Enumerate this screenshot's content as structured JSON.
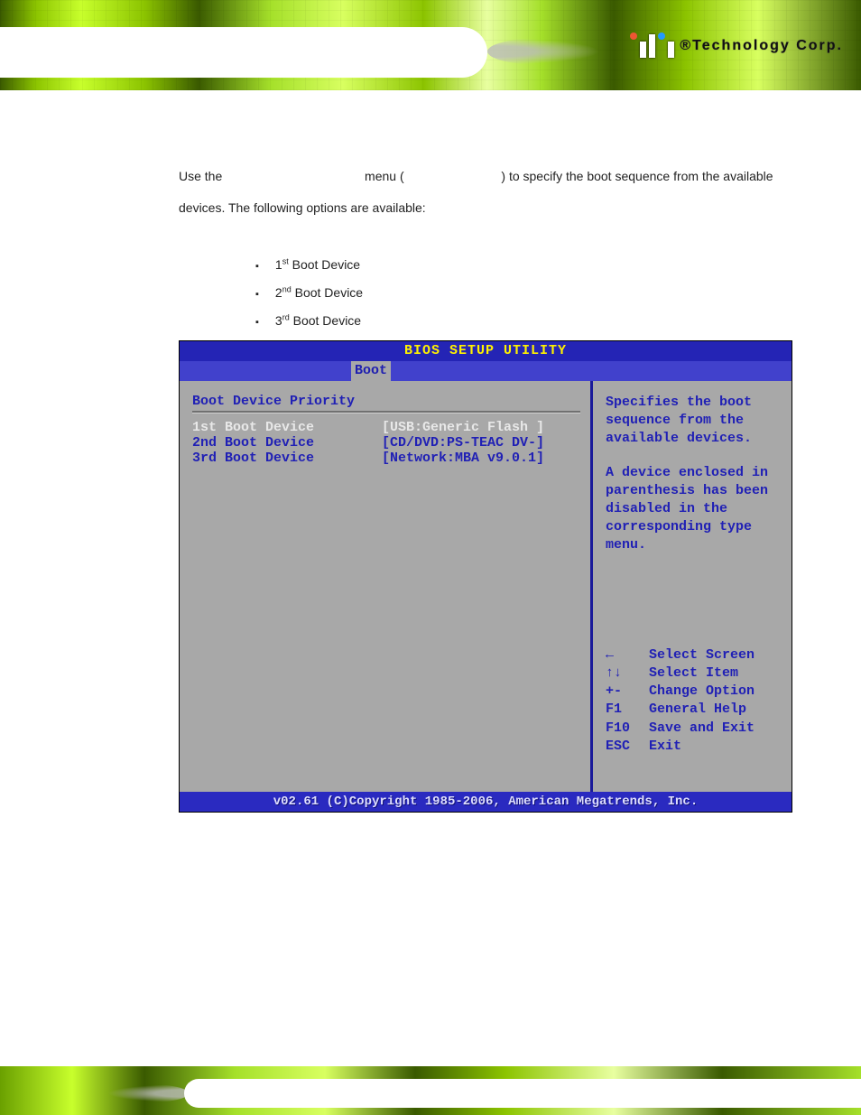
{
  "header": {
    "brand": "Technology Corp",
    "registered": "®"
  },
  "body": {
    "intro_part1": "Use the ",
    "intro_part2": " menu (",
    "intro_part3": ") to specify the boot sequence from the available devices. The following options are available:",
    "bullets": [
      {
        "ord": "1",
        "sup": "st",
        "rest": " Boot Device"
      },
      {
        "ord": "2",
        "sup": "nd",
        "rest": " Boot Device"
      },
      {
        "ord": "3",
        "sup": "rd",
        "rest": " Boot Device"
      }
    ]
  },
  "bios": {
    "title": "BIOS SETUP UTILITY",
    "active_tab": "Boot",
    "panel_heading": "Boot Device Priority",
    "rows": [
      {
        "label": "1st Boot Device",
        "value": "[USB:Generic Flash ]",
        "selected": true
      },
      {
        "label": "2nd Boot Device",
        "value": "[CD/DVD:PS-TEAC DV-]",
        "selected": false
      },
      {
        "label": "3rd Boot Device",
        "value": "[Network:MBA v9.0.1]",
        "selected": false
      }
    ],
    "help1": "Specifies the boot sequence from the available devices.",
    "help2": "A device enclosed in parenthesis has been disabled in the corresponding type menu.",
    "legend": [
      {
        "key": "←",
        "action": "Select Screen"
      },
      {
        "key": "↑↓",
        "action": "Select Item"
      },
      {
        "key": "+-",
        "action": "Change Option"
      },
      {
        "key": "F1",
        "action": "General Help"
      },
      {
        "key": "F10",
        "action": "Save and Exit"
      },
      {
        "key": "ESC",
        "action": "Exit"
      }
    ],
    "footer": "v02.61 (C)Copyright 1985-2006, American Megatrends, Inc."
  }
}
